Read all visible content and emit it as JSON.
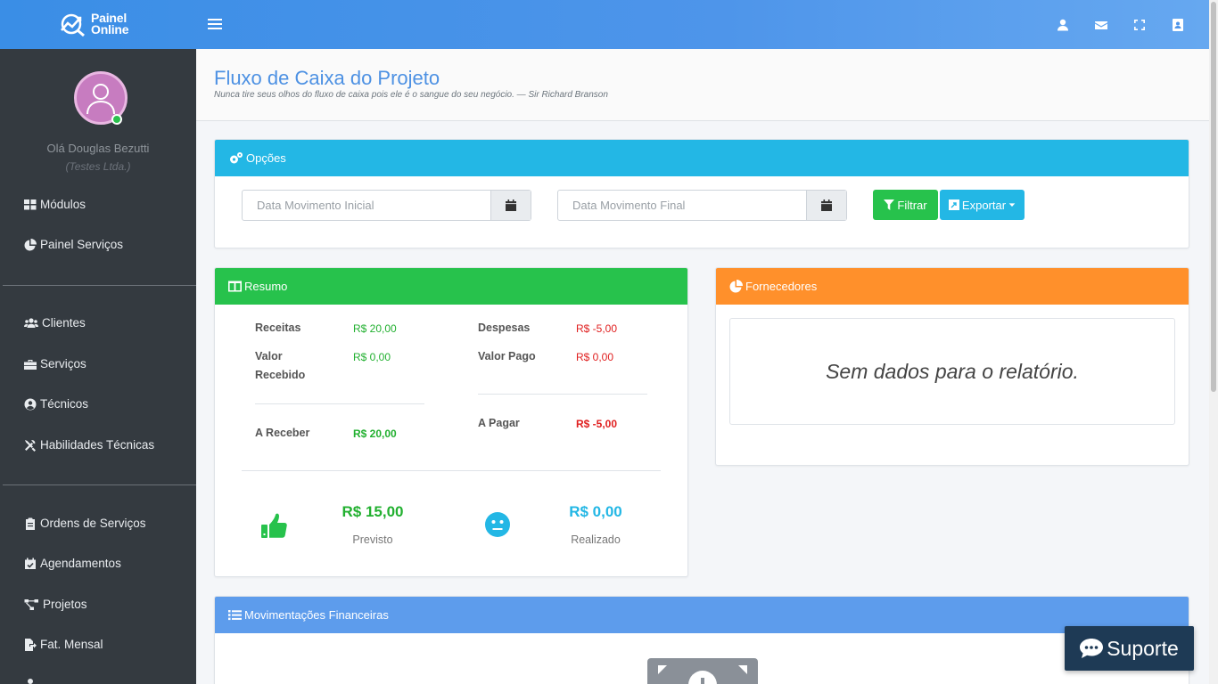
{
  "app": {
    "logo_line1": "Painel",
    "logo_line2": "Online"
  },
  "topbar": {
    "icons": [
      "user-icon",
      "envelope-icon",
      "expand-icon",
      "address-book-icon"
    ]
  },
  "sidebar": {
    "greeting": "Olá Douglas Bezutti",
    "company": "(Testes Ltda.)",
    "items": [
      {
        "label": "Módulos",
        "icon": "grid-icon"
      },
      {
        "label": "Painel Serviços",
        "icon": "pie-chart-icon"
      },
      {
        "label": "Clientes",
        "icon": "users-icon"
      },
      {
        "label": "Serviços",
        "icon": "briefcase-icon"
      },
      {
        "label": "Técnicos",
        "icon": "user-circle-icon"
      },
      {
        "label": "Habilidades Técnicas",
        "icon": "tools-icon"
      },
      {
        "label": "Ordens de Serviços",
        "icon": "clipboard-icon"
      },
      {
        "label": "Agendamentos",
        "icon": "calendar-check-icon"
      },
      {
        "label": "Projetos",
        "icon": "project-diagram-icon"
      },
      {
        "label": "Fat. Mensal",
        "icon": "file-export-icon"
      }
    ]
  },
  "header": {
    "title": "Fluxo de Caixa do Projeto",
    "quote": "Nunca tire seus olhos do fluxo de caixa pois ele é o sangue do seu negócio. — Sir Richard Branson"
  },
  "opcoes": {
    "title": "Opções",
    "date_start_placeholder": "Data Movimento Inicial",
    "date_end_placeholder": "Data Movimento Final",
    "filter_label": "Filtrar",
    "export_label": "Exportar"
  },
  "resumo": {
    "title": "Resumo",
    "receitas_label": "Receitas",
    "receitas_value": "R$ 20,00",
    "despesas_label": "Despesas",
    "despesas_value": "R$ -5,00",
    "valor_recebido_label_1": "Valor",
    "valor_recebido_label_2": "Recebido",
    "valor_recebido_value": "R$ 0,00",
    "valor_pago_label": "Valor Pago",
    "valor_pago_value": "R$ 0,00",
    "a_receber_label": "A Receber",
    "a_receber_value": "R$ 20,00",
    "a_pagar_label": "A Pagar",
    "a_pagar_value": "R$ -5,00",
    "previsto_value": "R$ 15,00",
    "previsto_label": "Previsto",
    "realizado_value": "R$ 0,00",
    "realizado_label": "Realizado"
  },
  "fornecedores": {
    "title": "Fornecedores",
    "empty_message": "Sem dados para o relatório."
  },
  "movimentacoes": {
    "title": "Movimentações Financeiras"
  },
  "support": {
    "label": "Suporte"
  },
  "colors": {
    "topbar": "#4e95ea",
    "sidebar": "#343a40",
    "info": "#23b7e5",
    "success": "#27c24c",
    "warning": "#ff902b",
    "primary": "#5d9cec",
    "support": "#1e3a55"
  }
}
